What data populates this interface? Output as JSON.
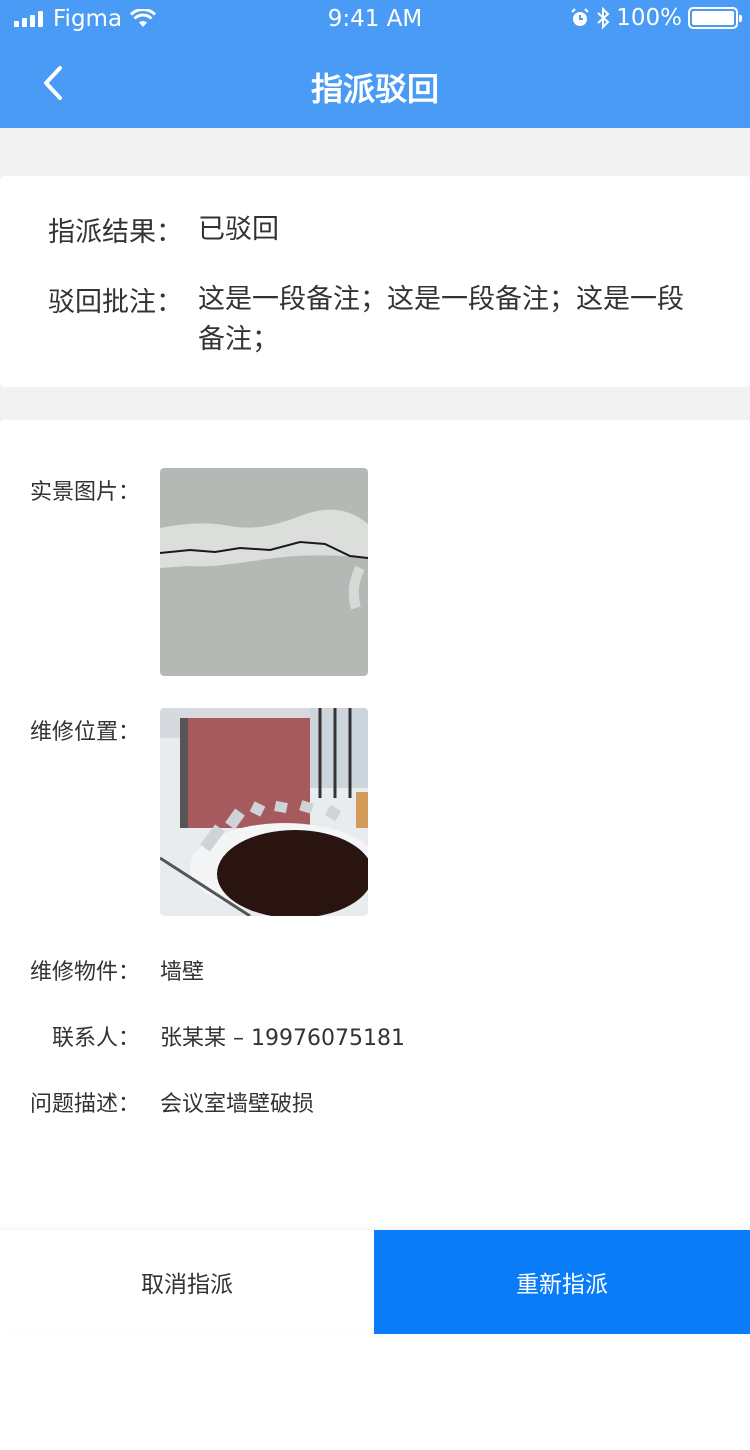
{
  "status_bar": {
    "carrier": "Figma",
    "time": "9:41 AM",
    "battery": "100%"
  },
  "nav": {
    "title": "指派驳回",
    "back_icon": "chevron-left-icon"
  },
  "result": {
    "result_label": "指派结果：",
    "result_value": "已驳回",
    "note_label": "驳回批注：",
    "note_value": "这是一段备注；这是一段备注；这是一段备注；"
  },
  "detail": {
    "photo_label": "实景图片：",
    "location_label": "维修位置：",
    "component_label": "维修物件：",
    "component_value": "墙壁",
    "contact_label": "联系人：",
    "contact_value": "张某某 – 19976075181",
    "issue_label": "问题描述：",
    "issue_value": "会议室墙壁破损"
  },
  "actions": {
    "cancel_label": "取消指派",
    "reassign_label": "重新指派"
  },
  "colors": {
    "header": "#4a9bf5",
    "primary_button": "#0a7cf8",
    "page_background": "#f2f2f2"
  }
}
